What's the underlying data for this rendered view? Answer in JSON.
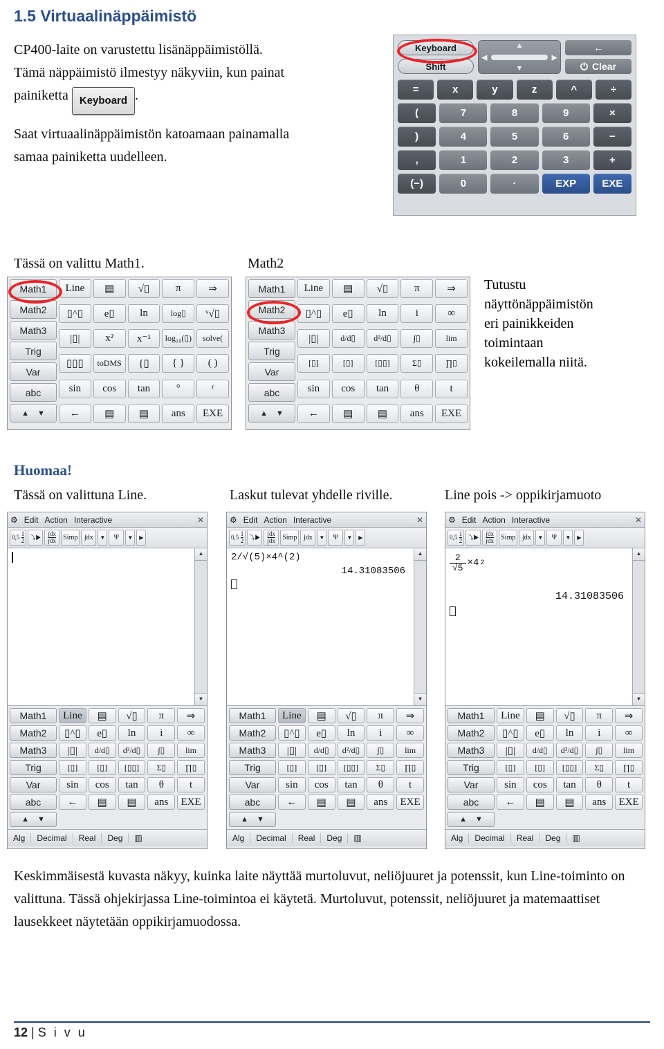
{
  "heading": "1.5 Virtuaalinäppäimistö",
  "intro": {
    "line1": "CP400-laite on varustettu lisänäppäimistöllä.",
    "line2": "Tämä näppäimistö ilmestyy näkyviin, kun painat",
    "line3_before": "painiketta",
    "keyboard_button": "Keyboard",
    "line3_after": ".",
    "para2_line1": "Saat virtuaalinäppäimistön katoamaan painamalla",
    "para2_line2": "samaa painiketta uudelleen."
  },
  "keyboard_image": {
    "pill_keyboard": "Keyboard",
    "pill_shift": "Shift",
    "btn_back": "←",
    "btn_clear": "Clear",
    "rows": [
      [
        "=",
        "x",
        "y",
        "z",
        "^",
        "÷"
      ],
      [
        "(",
        "7",
        "8",
        "9",
        "×"
      ],
      [
        ")",
        "4",
        "5",
        "6",
        "−"
      ],
      [
        ",",
        "1",
        "2",
        "3",
        "+"
      ],
      [
        "(−)",
        "0",
        "·",
        "EXP",
        "EXE"
      ]
    ]
  },
  "labels": {
    "math1_selected": "Tässä on valittu Math1.",
    "math2": "Math2",
    "tutustu": "Tutustu\nnäyttönäppäimistön\neri painikkeiden\ntoimintaan\nkokeilemalla niitä.",
    "tutustu_lines": [
      "Tutustu",
      "näyttönäppäimistön",
      "eri painikkeiden",
      "toimintaan",
      "kokeilemalla niitä."
    ],
    "huomaa": "Huomaa!",
    "line_selected": "Tässä on valittuna Line.",
    "one_line": "Laskut tulevat yhdelle riville.",
    "line_off": "Line pois -> oppikirjamuoto"
  },
  "softkeyboard": {
    "tabs": [
      "Math1",
      "Math2",
      "Math3",
      "Trig",
      "Var",
      "abc"
    ],
    "nav": "▲ ▼",
    "math1_keys": [
      "Line",
      "▤",
      "√▯",
      "π",
      "⇒",
      "▯^▯",
      "e▯",
      "ln",
      "log▯",
      "ᵛ√▯",
      "|▯|",
      "x²",
      "x⁻¹",
      "log₁₀(▯)",
      "solve(",
      "▯▯▯",
      "toDMS",
      "{▯",
      "{ }",
      "( )",
      "sin",
      "cos",
      "tan",
      "°",
      "ʳ",
      "←",
      "▤",
      "▤",
      "ans",
      "EXE"
    ],
    "math2_keys": [
      "Line",
      "▤",
      "√▯",
      "π",
      "⇒",
      "▯^▯",
      "e▯",
      "ln",
      "i",
      "∞",
      "|▯|",
      "d/d▯",
      "d²/d▯",
      "∫▯",
      "lim",
      "[▯]",
      "[▯]",
      "[▯▯]",
      "Σ▯",
      "∏▯",
      "sin",
      "cos",
      "tan",
      "θ",
      "t",
      "←",
      "▤",
      "▤",
      "ans",
      "EXE"
    ]
  },
  "calculators": [
    {
      "title_menu": [
        "Edit",
        "Action",
        "Interactive"
      ],
      "toolbar": [
        "0.5 1/2",
        "▷",
        "∫dx/∫dx",
        "Simp",
        "∫dx",
        "▼",
        "Ψ",
        "▼",
        "▷"
      ],
      "screen_expression": "",
      "screen_result": "",
      "status": [
        "Alg",
        "Decimal",
        "Real",
        "Deg",
        "▥"
      ],
      "line_selected": true
    },
    {
      "title_menu": [
        "Edit",
        "Action",
        "Interactive"
      ],
      "toolbar": [
        "0.5 1/2",
        "▷",
        "∫dx/∫dx",
        "Simp",
        "∫dx",
        "▼",
        "Ψ",
        "▼",
        "▷"
      ],
      "screen_expression": "2/√(5)×4^(2)",
      "screen_result": "14.31083506",
      "status": [
        "Alg",
        "Decimal",
        "Real",
        "Deg",
        "▥"
      ],
      "line_selected": true
    },
    {
      "title_menu": [
        "Edit",
        "Action",
        "Interactive"
      ],
      "toolbar": [
        "0.5 1/2",
        "▷",
        "∫dx/∫dx",
        "Simp",
        "∫dx",
        "▼",
        "Ψ",
        "▼",
        "▷"
      ],
      "screen_expression_num": "2",
      "screen_expression_den": "√5",
      "screen_expression_tail": "×4",
      "screen_expression_exp": "2",
      "screen_result": "14.31083506",
      "status": [
        "Alg",
        "Decimal",
        "Real",
        "Deg",
        "▥"
      ],
      "line_selected": false
    }
  ],
  "bottom_paragraph": "Keskimmäisestä kuvasta näkyy, kuinka laite näyttää murtoluvut, neliöjuuret ja potenssit, kun Line-toiminto on valittuna. Tässä ohjekirjassa Line-toimintoa ei käytetä. Murtoluvut, potenssit, neliöjuuret ja matemaattiset lausekkeet näytetään oppikirjamuodossa.",
  "footer": {
    "page_number": "12",
    "separator": "|",
    "label": "S i v u"
  },
  "colors": {
    "heading_blue": "#2a4e8c",
    "annotation_red": "#e8252a",
    "footer_rule": "#1b3f7a"
  }
}
